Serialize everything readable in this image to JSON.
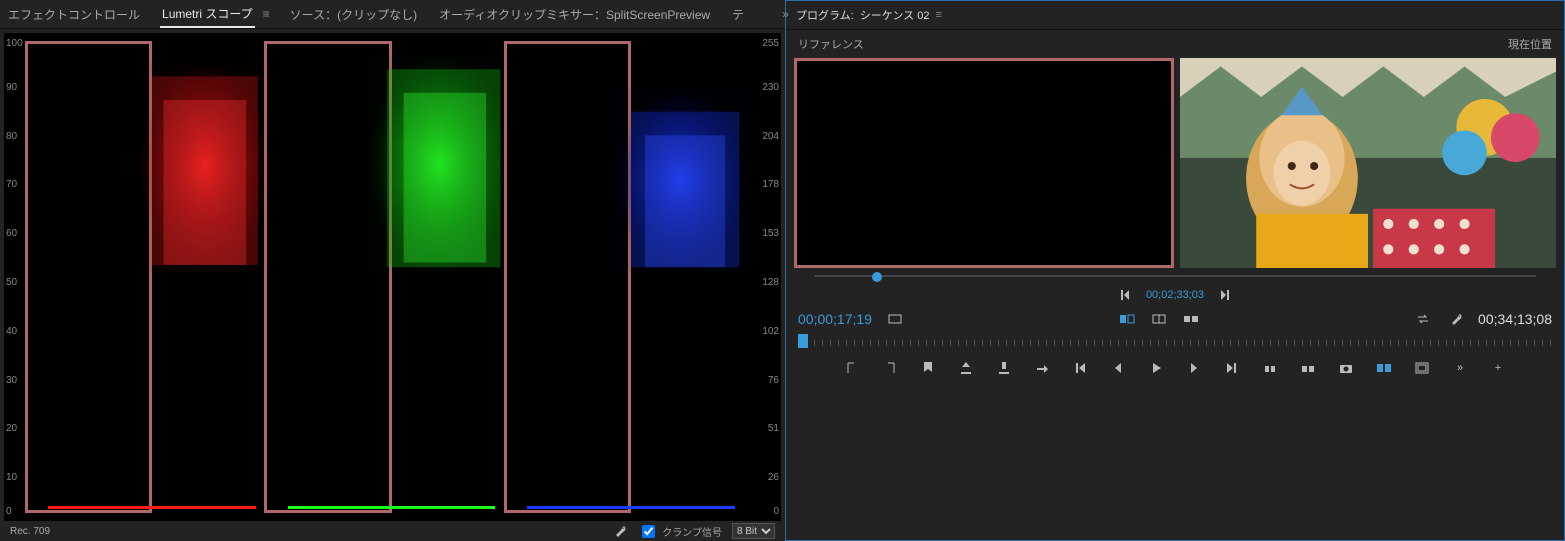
{
  "tabs": {
    "effect_controls": "エフェクトコントロール",
    "lumetri_scopes": "Lumetri スコープ",
    "source": "ソース：(クリップなし)",
    "audio_mixer": "オーディオクリップミキサー：SplitScreenPreview",
    "truncated": "テ"
  },
  "scope": {
    "left_ticks": [
      "100",
      "90",
      "80",
      "70",
      "60",
      "50",
      "40",
      "30",
      "20",
      "10",
      "0"
    ],
    "right_ticks": [
      "255",
      "230",
      "204",
      "178",
      "153",
      "128",
      "102",
      "76",
      "51",
      "26",
      "0"
    ],
    "colorspace": "Rec. 709",
    "clamp_label": "クランプ信号",
    "bit_depth": "8 Bit"
  },
  "program": {
    "title_prefix": "プログラム:",
    "sequence": "シーケンス 02",
    "reference_label": "リファレンス",
    "current_label": "現在位置",
    "ref_timecode": "00;02;33;03",
    "playhead_tc": "00;00;17;19",
    "duration_tc": "00;34;13;08"
  },
  "icons": {
    "menu": "≡",
    "more": "»",
    "plus": "+"
  }
}
